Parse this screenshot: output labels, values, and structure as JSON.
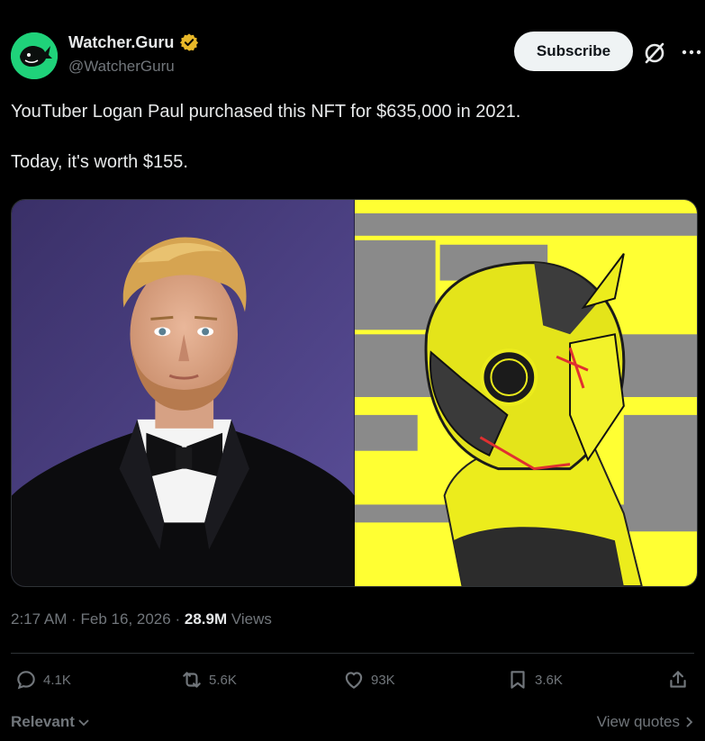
{
  "account": {
    "display_name": "Watcher.Guru",
    "handle": "@WatcherGuru",
    "verified": true
  },
  "header": {
    "subscribe_label": "Subscribe"
  },
  "tweet": {
    "line1": "YouTuber Logan Paul purchased this NFT for $635,000 in 2021.",
    "line2": "Today, it's worth $155."
  },
  "meta": {
    "time": "2:17 AM",
    "separator": "·",
    "date": "Feb 16, 2026",
    "views_count": "28.9M",
    "views_label": "Views"
  },
  "actions": {
    "replies": "4.1K",
    "reposts": "5.6K",
    "likes": "93K",
    "bookmarks": "3.6K"
  },
  "footer": {
    "relevant_label": "Relevant",
    "view_quotes_label": "View quotes"
  },
  "colors": {
    "background": "#000000",
    "text_primary": "#e7e9ea",
    "text_secondary": "#71767b",
    "verified_gold": "#e8b829",
    "avatar_green": "#1fd27a",
    "nft_yellow": "#ffff33"
  }
}
